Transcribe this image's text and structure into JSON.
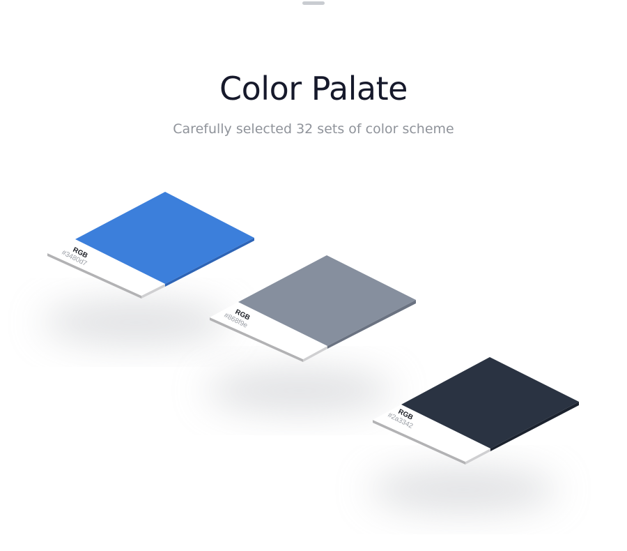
{
  "header": {
    "title": "Color Palate",
    "subtitle": "Carefully selected 32 sets of color scheme"
  },
  "swatches": [
    {
      "label": "RGB",
      "hex_label": "#3480d7",
      "color": "#3c7fdb",
      "edge_color": "#2d64b6"
    },
    {
      "label": "RGB",
      "hex_label": "#868f9e",
      "color": "#868f9e",
      "edge_color": "#6a7281"
    },
    {
      "label": "RGB",
      "hex_label": "#2a3342",
      "color": "#2a3342",
      "edge_color": "#1b222e"
    }
  ],
  "card": {
    "paper_color": "#ffffff",
    "paper_edge_color": "#b2b2b4",
    "label_color": "#1c1f26",
    "hex_color": "#9a9ea5"
  }
}
